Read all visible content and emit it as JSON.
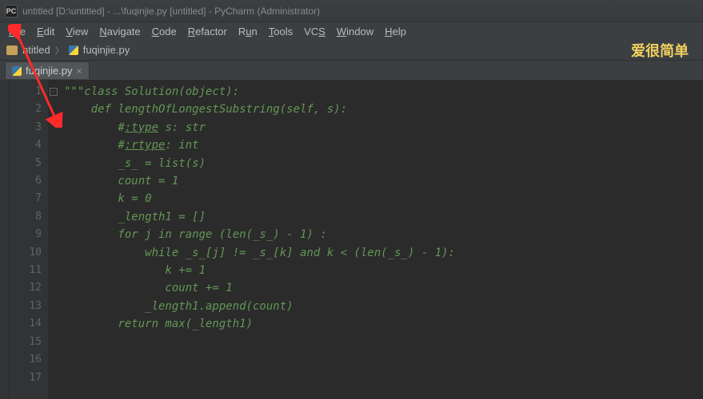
{
  "title": "untitled [D:\\untitled] - ...\\fuqinjie.py [untitled] - PyCharm (Administrator)",
  "app_icon_label": "PC",
  "menu": {
    "file": "File",
    "edit": "Edit",
    "view": "View",
    "navigate": "Navigate",
    "code": "Code",
    "refactor": "Refactor",
    "run": "Run",
    "tools": "Tools",
    "vcs": "VCS",
    "window": "Window",
    "help": "Help"
  },
  "breadcrumb": {
    "project": "ntitled",
    "file": "fuqinjie.py"
  },
  "watermark": "爱很简单",
  "tab": {
    "name": "fuqinjie.py",
    "close": "×"
  },
  "fold_mark": "–",
  "line_numbers": [
    "1",
    "2",
    "3",
    "4",
    "5",
    "6",
    "7",
    "8",
    "9",
    "10",
    "11",
    "12",
    "13",
    "14",
    "15",
    "16",
    "17"
  ],
  "code_lines": [
    "\"\"\"class Solution(object):",
    "    def lengthOfLongestSubstring(self, s):",
    "",
    "        #_:type_ s: str",
    "        #_:rtype_: int",
    "",
    "        _s_ = list(s)",
    "        count = 1",
    "        k = 0",
    "        _length1 = []",
    "        for j in range (len(_s_) - 1) :",
    "            while _s_[j] != _s_[k] and k < (len(_s_) - 1):",
    "               k += 1",
    "               count += 1",
    "            _length1.append(count)",
    "        return max(_length1)",
    ""
  ]
}
